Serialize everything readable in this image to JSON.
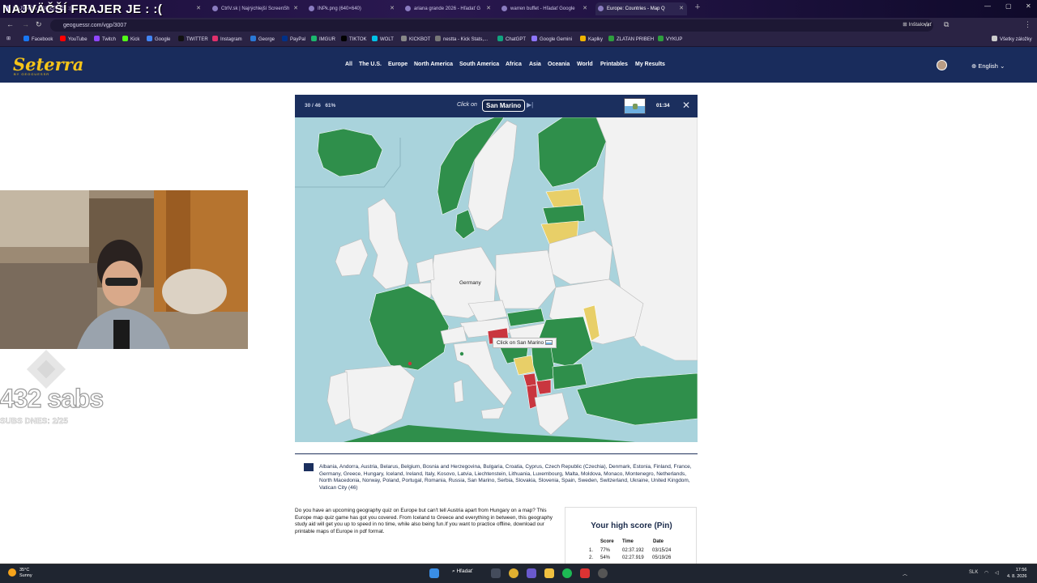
{
  "browser": {
    "tabs": [
      {
        "label": "NAJVÄČŠÍ FRAJER JE : :(",
        "active": false
      },
      {
        "label": "CtrlV.sk | Najrýchlejší ScreenSh",
        "active": false
      },
      {
        "label": "INPk.png (640×640)",
        "active": false
      },
      {
        "label": "ariana grande 2026 - Hľadať G",
        "active": false
      },
      {
        "label": "warren buffet - Hľadať Google",
        "active": false
      },
      {
        "label": "Europe: Countries - Map Q",
        "active": true
      }
    ],
    "url": "geoguessr.com/vgp/3007",
    "install_label": "Inštalovať",
    "bookmarks": [
      {
        "label": "Facebook",
        "color": "#1877f2"
      },
      {
        "label": "YouTube",
        "color": "#ff0000"
      },
      {
        "label": "Twitch",
        "color": "#9146ff"
      },
      {
        "label": "Kick",
        "color": "#53fc18"
      },
      {
        "label": "Google",
        "color": "#4285f4"
      },
      {
        "label": "TWITTER",
        "color": "#111111"
      },
      {
        "label": "Instagram",
        "color": "#e1306c"
      },
      {
        "label": "George",
        "color": "#2a78d6"
      },
      {
        "label": "PayPal",
        "color": "#003087"
      },
      {
        "label": "IMGUR",
        "color": "#1bb76e"
      },
      {
        "label": "TIKTOK",
        "color": "#010101"
      },
      {
        "label": "WOLT",
        "color": "#00c2e8"
      },
      {
        "label": "KICKBOT",
        "color": "#888888"
      },
      {
        "label": "nestta - Kick Stats,...",
        "color": "#777777"
      },
      {
        "label": "ChatGPT",
        "color": "#10a37f"
      },
      {
        "label": "Google Gemini",
        "color": "#8e75ff"
      },
      {
        "label": "Kaplky",
        "color": "#f0b400"
      },
      {
        "label": "ZLATAN PRIBEH",
        "color": "#2e9e3e"
      },
      {
        "label": "VYKUP",
        "color": "#2e9e3e"
      }
    ],
    "all_bookmarks": "Všetky záložky"
  },
  "overlay": {
    "title": "NAJVÄČŠÍ FRAJER JE : :(",
    "subs_count": "432 sabs",
    "subs_today": "SUBS DNES: 2/25"
  },
  "site": {
    "logo": "Seterra",
    "logo_sub": "BY GEOGUESSR",
    "nav": [
      "All",
      "The U.S.",
      "Europe",
      "North America",
      "South America",
      "Africa",
      "Asia",
      "Oceania",
      "World",
      "Printables",
      "My Results"
    ],
    "language": "English"
  },
  "game": {
    "progress": "30 / 46",
    "percent": "61%",
    "click_on": "Click on",
    "target": "San Marino",
    "timer": "01:34",
    "tooltip": "Click on San Marino",
    "map_label": "Germany",
    "colors": {
      "correct": "#2f8f4b",
      "second_try": "#e8cf68",
      "wrong": "#c9363f",
      "unanswered": "#f2f2f2",
      "sea": "#a9d3dc",
      "bar": "#1b2f5e"
    }
  },
  "info": {
    "countries": "Albania, Andorra, Austria, Belarus, Belgium, Bosnia and Herzegovina, Bulgaria, Croatia, Cyprus, Czech Republic (Czechia), Denmark, Estonia, Finland, France, Germany, Greece, Hungary, Iceland, Ireland, Italy, Kosovo, Latvia, Liechtenstein, Lithuania, Luxembourg, Malta, Moldova, Monaco, Montenegro, Netherlands, North Macedonia, Norway, Poland, Portugal, Romania, Russia, San Marino, Serbia, Slovakia, Slovenia, Spain, Sweden, Switzerland, Ukraine, United Kingdom, Vatican City (46)",
    "description": "Do you have an upcoming geography quiz on Europe but can't tell Austria apart from Hungary on a map? This Europe map quiz game has got you covered. From Iceland to Greece and everything in between, this geography study aid will get you up to speed in no time, while also being fun.If you want to practice offline, download our printable maps of Europe in pdf format.",
    "high_score_title": "Your high score (Pin)",
    "score_headers": [
      "Score",
      "Time",
      "Date"
    ],
    "scores": [
      {
        "rank": "1.",
        "score": "77%",
        "time": "02:37.192",
        "date": "03/15/24"
      },
      {
        "rank": "2.",
        "score": "54%",
        "time": "02:27.919",
        "date": "05/19/26"
      }
    ]
  },
  "taskbar": {
    "temp": "35°C",
    "weather": "Sunny",
    "search": "Hľadať",
    "lang": "SLK",
    "time": "17:56",
    "date": "4. 8. 2026"
  }
}
